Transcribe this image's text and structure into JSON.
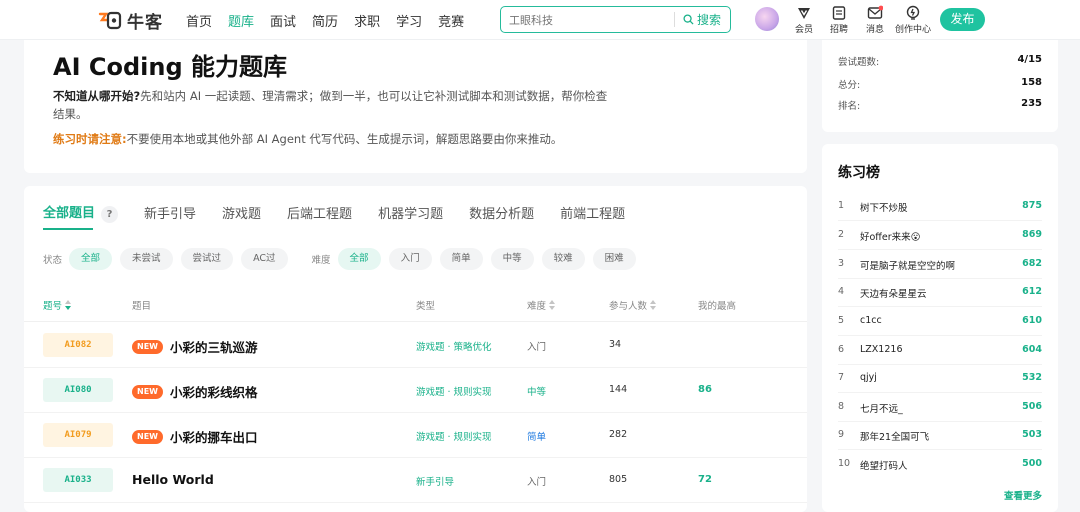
{
  "nav": {
    "logo_text": "牛客",
    "items": [
      {
        "label": "首页",
        "active": false
      },
      {
        "label": "题库",
        "active": true
      },
      {
        "label": "面试",
        "active": false
      },
      {
        "label": "简历",
        "active": false
      },
      {
        "label": "求职",
        "active": false
      },
      {
        "label": "学习",
        "active": false
      },
      {
        "label": "竞赛",
        "active": false
      }
    ],
    "search_placeholder": "工眼科技",
    "search_button": "搜索",
    "icons": [
      {
        "label": "会员",
        "icon": "vip-icon"
      },
      {
        "label": "招聘",
        "icon": "recruit-icon"
      },
      {
        "label": "消息",
        "icon": "message-icon"
      },
      {
        "label": "创作中心",
        "icon": "creator-icon"
      }
    ],
    "publish_label": "发布"
  },
  "header": {
    "title": "AI Coding 能力题库",
    "intro_bold": "不知道从哪开始?",
    "intro_text": "先和站内 AI 一起读题、理清需求；做到一半，也可以让它补测试脚本和测试数据，帮你检查结果。",
    "notice_bold": "练习时请注意:",
    "notice_text": "不要使用本地或其他外部 AI Agent 代写代码、生成提示词，解题思路要由你来推动。"
  },
  "tabs": [
    {
      "label": "全部题目",
      "active": true
    },
    {
      "label": "新手引导",
      "active": false
    },
    {
      "label": "游戏题",
      "active": false
    },
    {
      "label": "后端工程题",
      "active": false
    },
    {
      "label": "机器学习题",
      "active": false
    },
    {
      "label": "数据分析题",
      "active": false
    },
    {
      "label": "前端工程题",
      "active": false
    }
  ],
  "tab_help": "?",
  "filters": {
    "status_label": "状态",
    "status_options": [
      {
        "label": "全部",
        "active": true
      },
      {
        "label": "未尝试",
        "active": false
      },
      {
        "label": "尝试过",
        "active": false
      },
      {
        "label": "AC过",
        "active": false
      }
    ],
    "difficulty_label": "难度",
    "difficulty_options": [
      {
        "label": "全部",
        "active": true
      },
      {
        "label": "入门",
        "active": false
      },
      {
        "label": "简单",
        "active": false
      },
      {
        "label": "中等",
        "active": false
      },
      {
        "label": "较难",
        "active": false
      },
      {
        "label": "困难",
        "active": false
      }
    ]
  },
  "table": {
    "headers": {
      "id": "题号",
      "title": "题目",
      "type": "类型",
      "difficulty": "难度",
      "participants": "参与人数",
      "best": "我的最高"
    },
    "rows": [
      {
        "id": "AI082",
        "id_color": "orange",
        "new": "NEW",
        "title": "小彩的三轨巡游",
        "type": "游戏题 · 策略优化",
        "difficulty": "入门",
        "diff_class": "easy",
        "participants": "34",
        "best": ""
      },
      {
        "id": "AI080",
        "id_color": "green",
        "new": "NEW",
        "title": "小彩的彩线织格",
        "type": "游戏题 · 规则实现",
        "difficulty": "中等",
        "diff_class": "medium",
        "participants": "144",
        "best": "86"
      },
      {
        "id": "AI079",
        "id_color": "orange",
        "new": "NEW",
        "title": "小彩的挪车出口",
        "type": "游戏题 · 规则实现",
        "difficulty": "简单",
        "diff_class": "simple",
        "participants": "282",
        "best": ""
      },
      {
        "id": "AI033",
        "id_color": "green",
        "new": "",
        "title": "Hello World",
        "type": "新手引导",
        "difficulty": "入门",
        "diff_class": "easy",
        "participants": "805",
        "best": "72"
      }
    ]
  },
  "stats": [
    {
      "label": "尝试题数:",
      "value": "4/15"
    },
    {
      "label": "总分:",
      "value": "158"
    },
    {
      "label": "排名:",
      "value": "235"
    }
  ],
  "ranking": {
    "title": "练习榜",
    "items": [
      {
        "rank": "1",
        "name": "树下不炒股",
        "score": "875"
      },
      {
        "rank": "2",
        "name": "好offer来来😮",
        "score": "869"
      },
      {
        "rank": "3",
        "name": "可是脑子就是空空的啊",
        "score": "682"
      },
      {
        "rank": "4",
        "name": "天边有朵星星云",
        "score": "612"
      },
      {
        "rank": "5",
        "name": "c1cc",
        "score": "610"
      },
      {
        "rank": "6",
        "name": "LZX1216",
        "score": "604"
      },
      {
        "rank": "7",
        "name": "qjyj",
        "score": "532"
      },
      {
        "rank": "8",
        "name": "七月不远_",
        "score": "506"
      },
      {
        "rank": "9",
        "name": "那年21全国可飞",
        "score": "503"
      },
      {
        "rank": "10",
        "name": "绝望打码人",
        "score": "500"
      }
    ],
    "see_more": "查看更多"
  },
  "colors": {
    "accent": "#19b18a",
    "orange": "#f29c1f",
    "new_badge": "#ff6a2b",
    "link_blue": "#1e7ae0"
  }
}
